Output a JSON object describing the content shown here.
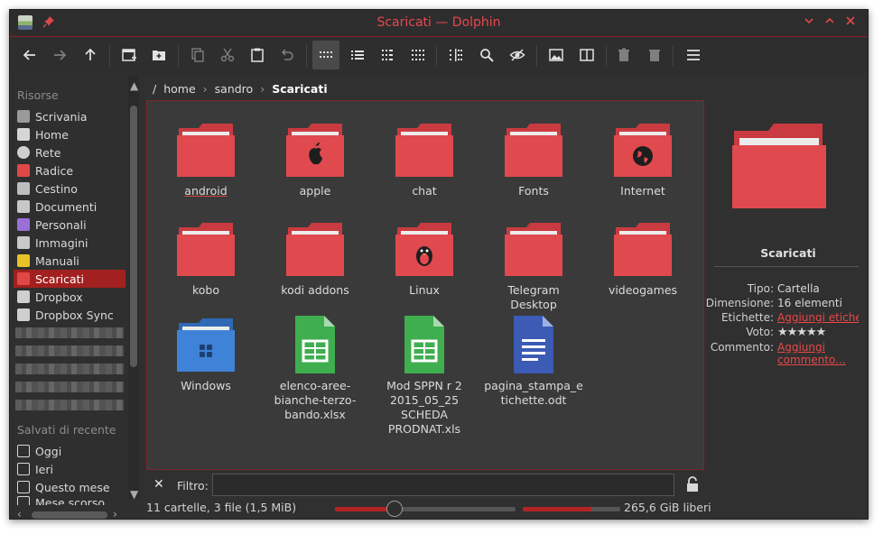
{
  "window": {
    "title": "Scaricati — Dolphin"
  },
  "toolbar": {
    "buttons": [
      "back-icon",
      "forward-icon",
      "up-icon",
      "new-tab-icon",
      "new-folder-icon",
      "copy-icon",
      "cut-icon",
      "paste-icon",
      "undo-icon",
      "icons-view-icon",
      "details-view-icon",
      "compact-view-icon",
      "grid-view-icon",
      "columns-icon",
      "search-icon",
      "hidden-files-icon",
      "preview-icon",
      "split-icon",
      "trash-icon",
      "delete-icon",
      "menu-icon"
    ]
  },
  "sidebar": {
    "places_title": "Risorse",
    "places": [
      {
        "label": "Scrivania",
        "icon": "desktop-icon",
        "color": "#9a9a9a"
      },
      {
        "label": "Home",
        "icon": "home-icon",
        "color": "#d6d6d6"
      },
      {
        "label": "Rete",
        "icon": "network-icon",
        "color": "#cfcfcf"
      },
      {
        "label": "Radice",
        "icon": "root-folder-icon",
        "color": "#e04848"
      },
      {
        "label": "Cestino",
        "icon": "trash-icon",
        "color": "#bdbdbd"
      },
      {
        "label": "Documenti",
        "icon": "documents-folder-icon",
        "color": "#c8c8c8"
      },
      {
        "label": "Personali",
        "icon": "personal-folder-icon",
        "color": "#9a6fd8"
      },
      {
        "label": "Immagini",
        "icon": "pictures-icon",
        "color": "#c9c9c9"
      },
      {
        "label": "Manuali",
        "icon": "manuals-folder-icon",
        "color": "#e8c226"
      },
      {
        "label": "Scaricati",
        "icon": "downloads-folder-icon",
        "color": "#e04848"
      },
      {
        "label": "Dropbox",
        "icon": "dropbox-icon",
        "color": "#cfcfcf"
      },
      {
        "label": "Dropbox Sync",
        "icon": "dropbox-icon",
        "color": "#cfcfcf"
      }
    ],
    "recent_title": "Salvati di recente",
    "recent": [
      {
        "label": "Oggi",
        "icon": "calendar-today-icon"
      },
      {
        "label": "Ieri",
        "icon": "calendar-yesterday-icon"
      },
      {
        "label": "Questo mese",
        "icon": "calendar-month-icon"
      },
      {
        "label": "Mese scorso",
        "icon": "calendar-last-month-icon"
      }
    ]
  },
  "breadcrumb": {
    "root": "/",
    "parts": [
      "home",
      "sandro"
    ],
    "current": "Scaricati"
  },
  "files": [
    {
      "label": "android",
      "type": "folder",
      "emblem": ""
    },
    {
      "label": "apple",
      "type": "folder",
      "emblem": "apple"
    },
    {
      "label": "chat",
      "type": "folder",
      "emblem": ""
    },
    {
      "label": "Fonts",
      "type": "folder",
      "emblem": ""
    },
    {
      "label": "Internet",
      "type": "folder",
      "emblem": "globe"
    },
    {
      "label": "kobo",
      "type": "folder",
      "emblem": ""
    },
    {
      "label": "kodi addons",
      "type": "folder",
      "emblem": ""
    },
    {
      "label": "Linux",
      "type": "folder",
      "emblem": "tux"
    },
    {
      "label": "Telegram Desktop",
      "type": "folder",
      "emblem": ""
    },
    {
      "label": "videogames",
      "type": "folder",
      "emblem": ""
    },
    {
      "label": "Windows",
      "type": "folder-blue",
      "emblem": "windows"
    },
    {
      "label": "elenco-aree-bianche-terzo-bando.xlsx",
      "type": "spreadsheet",
      "emblem": ""
    },
    {
      "label": "Mod SPPN r 2 2015_05_25 SCHEDA PRODNAT.xls",
      "type": "spreadsheet",
      "emblem": ""
    },
    {
      "label": "pagina_stampa_etichette.odt",
      "type": "document",
      "emblem": ""
    }
  ],
  "info": {
    "name": "Scaricati",
    "tipo_k": "Tipo:",
    "tipo_v": "Cartella",
    "dim_k": "Dimensione:",
    "dim_v": "16 elementi",
    "etichette_k": "Etichette:",
    "etichette_v": "Aggiungi etichette",
    "voto_k": "Voto:",
    "voto_v": "★★★★★",
    "commento_k": "Commento:",
    "commento_v1": "Aggiungi",
    "commento_v2": "commento..."
  },
  "filter": {
    "label": "Filtro:",
    "value": ""
  },
  "status": {
    "summary": "11 cartelle, 3 file (1,5 MiB)",
    "free": "265,6 GiB liberi",
    "zoom_fraction": 0.33,
    "used_fraction": 0.7
  },
  "colors": {
    "accent": "#e04848",
    "folder": "#e04a4f",
    "folder_tab": "#c93b40",
    "blue_folder": "#3f83d9",
    "sheet": "#3fae4f",
    "doc": "#3b5bb5"
  }
}
